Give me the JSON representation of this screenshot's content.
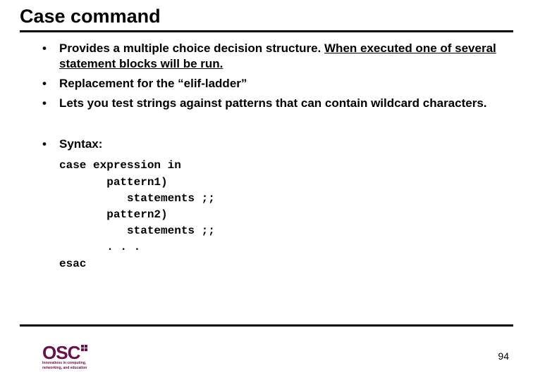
{
  "title": "Case command",
  "bullets_group1": [
    {
      "prefix": "Provides a multiple choice decision structure. ",
      "underlined": "When executed one of several statement blocks will be run."
    },
    {
      "text": "Replacement for the “elif-ladder”"
    },
    {
      "text": "Lets you test strings against patterns that can contain wildcard characters."
    }
  ],
  "syntax_label": "Syntax:",
  "code": "case expression in\n       pattern1)\n          statements ;;\n       pattern2)\n          statements ;;\n       . . .\nesac",
  "logo": {
    "text": "OSC",
    "subtitle_l1": "Innovations in computing,",
    "subtitle_l2": "networking, and education"
  },
  "page_number": "94"
}
